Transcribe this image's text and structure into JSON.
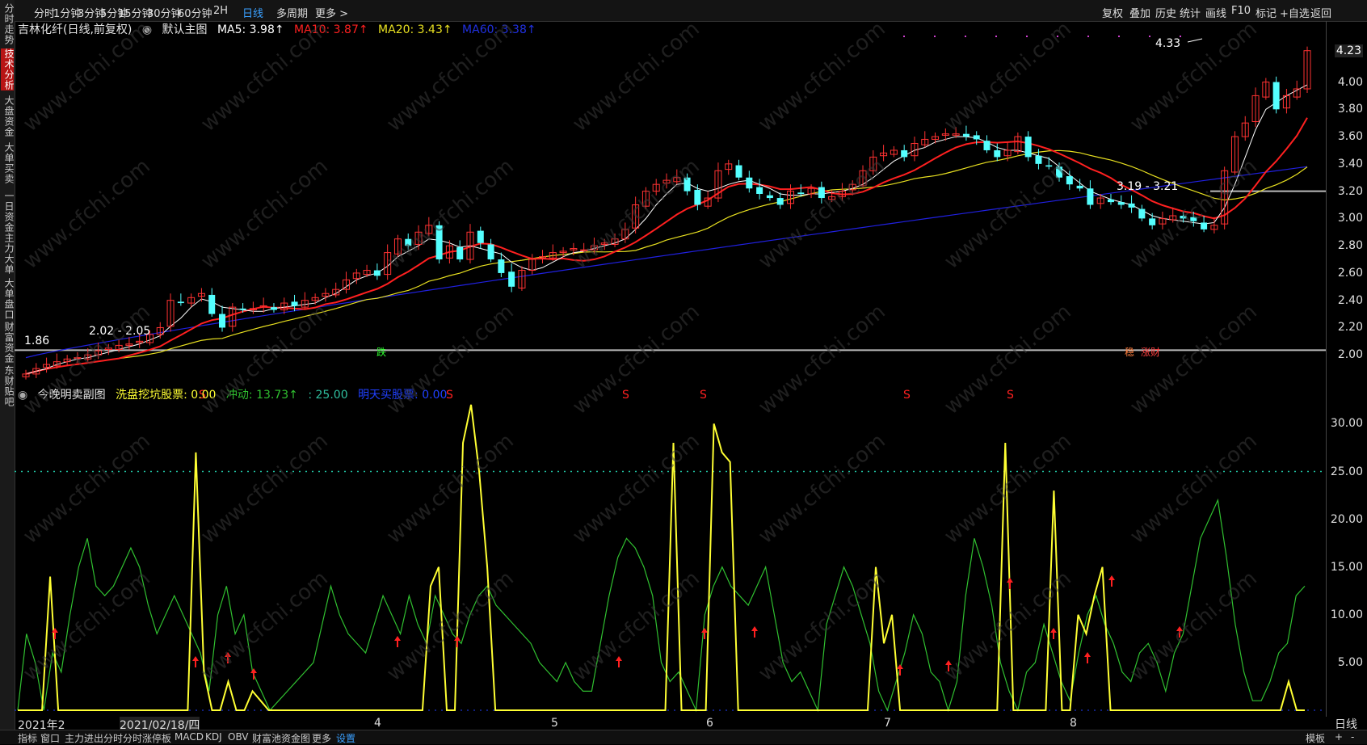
{
  "left_tabs": [
    "分时走势",
    "技术分析",
    "大盘资金",
    "大单买卖",
    "一日资金",
    "主力大单",
    "大单盘口",
    "财富资金",
    "东财贴吧"
  ],
  "left_active": 1,
  "periods": [
    "分时",
    "1分钟",
    "3分钟",
    "5分钟",
    "15分钟",
    "30分钟",
    "60分钟",
    "2H",
    "日线",
    "多周期",
    "更多 >"
  ],
  "period_active": "日线",
  "right_tools": [
    "复权",
    "叠加",
    "历史",
    "统计",
    "画线",
    "F10",
    "标记",
    "+自选",
    "返回"
  ],
  "main_legend": {
    "title": "吉林化纤(日线,前复权)",
    "chart_name": "默认主图",
    "ma5": "MA5: 3.98↑",
    "ma10": "MA10: 3.87↑",
    "ma20": "MA20: 3.43↑",
    "ma60": "MA60: 3.38↑"
  },
  "sub_legend": {
    "title": "今晚明卖副图",
    "xp": "洗盘挖坑股票: 0.00",
    "cd": "冲动: 13.73↑",
    "lv": ": 25.00",
    "mt": "明天买股票: 0.00"
  },
  "y_ticks_main": [
    "4.23",
    "4.00",
    "3.80",
    "3.60",
    "3.40",
    "3.20",
    "3.00",
    "2.80",
    "2.60",
    "2.40",
    "2.20",
    "2.00"
  ],
  "y_ticks_sub": [
    "30.00",
    "25.00",
    "20.00",
    "15.00",
    "10.00",
    "5.00"
  ],
  "x_labels": [
    "2021年2",
    "2021/02/18/四",
    "4",
    "5",
    "6",
    "7",
    "8"
  ],
  "x_axis_right": "日线",
  "annotations": {
    "high": "4.33",
    "low": "1.86",
    "range1": "2.02 - 2.05",
    "range2": "3.19 - 3.21",
    "marker1": "跌",
    "marker2": "稳",
    "marker3": "涨财"
  },
  "bottom_tabs": [
    "指标",
    "窗口",
    "主力进出分时",
    "分时涨停板",
    "MACD",
    "KDJ",
    "OBV",
    "财富池资金图",
    "更多",
    "设置"
  ],
  "bottom_active": "设置",
  "bottom_right": [
    "模板",
    "+",
    "-"
  ],
  "watermark": "www.cfchi.com",
  "colors": {
    "up": "#ff3232",
    "down": "#54ffff",
    "ma5": "#ffffff",
    "ma10": "#ff2020",
    "ma20": "#e8e020",
    "ma60": "#2020e0",
    "sub_yellow": "#ffff33",
    "sub_green": "#30c030"
  },
  "chart_data": [
    {
      "type": "candlestick",
      "title": "吉林化纤(日线,前复权)",
      "ylim": [
        1.8,
        4.4
      ],
      "close": [
        1.86,
        1.9,
        1.93,
        1.95,
        1.97,
        1.98,
        2.0,
        2.03,
        2.05,
        2.07,
        2.08,
        2.1,
        2.15,
        2.2,
        2.4,
        2.38,
        2.42,
        2.45,
        2.3,
        2.2,
        2.35,
        2.33,
        2.34,
        2.36,
        2.33,
        2.38,
        2.36,
        2.4,
        2.42,
        2.45,
        2.48,
        2.55,
        2.6,
        2.62,
        2.58,
        2.75,
        2.85,
        2.8,
        2.9,
        2.95,
        2.7,
        2.8,
        2.7,
        2.9,
        2.82,
        2.7,
        2.6,
        2.5,
        2.62,
        2.7,
        2.72,
        2.75,
        2.76,
        2.78,
        2.77,
        2.8,
        2.82,
        2.85,
        2.92,
        3.1,
        3.2,
        3.25,
        3.28,
        3.3,
        3.2,
        3.1,
        3.15,
        3.35,
        3.4,
        3.3,
        3.22,
        3.18,
        3.15,
        3.1,
        3.2,
        3.18,
        3.22,
        3.15,
        3.16,
        3.2,
        3.25,
        3.35,
        3.45,
        3.48,
        3.5,
        3.45,
        3.55,
        3.58,
        3.6,
        3.62,
        3.62,
        3.6,
        3.58,
        3.5,
        3.45,
        3.5,
        3.6,
        3.45,
        3.4,
        3.38,
        3.3,
        3.25,
        3.22,
        3.1,
        3.15,
        3.12,
        3.1,
        3.08,
        3.0,
        2.95,
        3.0,
        3.02,
        3.0,
        2.98,
        2.92,
        2.95,
        3.35,
        3.6,
        3.7,
        3.9,
        4.0,
        3.8,
        3.9,
        3.95,
        4.23
      ],
      "ma5": [
        1.86,
        1.88,
        1.9,
        1.93,
        1.95,
        1.97,
        1.98,
        2.0,
        2.02,
        2.04,
        2.06,
        2.08,
        2.11,
        2.14,
        2.21,
        2.27,
        2.35,
        2.41,
        2.39,
        2.35,
        2.34,
        2.33,
        2.32,
        2.32,
        2.34,
        2.35,
        2.36,
        2.37,
        2.38,
        2.42,
        2.45,
        2.5,
        2.55,
        2.58,
        2.6,
        2.65,
        2.72,
        2.76,
        2.8,
        2.85,
        2.84,
        2.82,
        2.79,
        2.8,
        2.78,
        2.76,
        2.74,
        2.68,
        2.64,
        2.62,
        2.64,
        2.68,
        2.72,
        2.75,
        2.76,
        2.78,
        2.8,
        2.82,
        2.85,
        2.92,
        3.0,
        3.1,
        3.18,
        3.25,
        3.26,
        3.22,
        3.2,
        3.22,
        3.25,
        3.27,
        3.28,
        3.25,
        3.22,
        3.18,
        3.17,
        3.17,
        3.18,
        3.18,
        3.19,
        3.2,
        3.22,
        3.25,
        3.3,
        3.36,
        3.42,
        3.46,
        3.5,
        3.52,
        3.56,
        3.58,
        3.6,
        3.6,
        3.59,
        3.56,
        3.52,
        3.5,
        3.5,
        3.48,
        3.46,
        3.44,
        3.38,
        3.32,
        3.26,
        3.2,
        3.17,
        3.14,
        3.12,
        3.1,
        3.06,
        3.02,
        3.0,
        2.99,
        2.98,
        2.97,
        2.96,
        2.97,
        3.08,
        3.25,
        3.45,
        3.65,
        3.8,
        3.85,
        3.9,
        3.94,
        3.98
      ]
    },
    {
      "type": "line",
      "title": "今晚明卖副图",
      "ylim": [
        0,
        33
      ],
      "series": [
        {
          "name": "洗盘挖坑股票",
          "values": [
            0,
            0,
            0,
            0,
            14,
            0,
            0,
            0,
            0,
            0,
            0,
            0,
            0,
            0,
            0,
            0,
            0,
            0,
            0,
            0,
            0,
            0,
            27,
            4,
            0,
            0,
            3,
            0,
            0,
            2,
            1,
            0,
            0,
            0,
            0,
            0,
            0,
            0,
            0,
            0,
            0,
            0,
            0,
            0,
            0,
            0,
            0,
            0,
            0,
            0,
            0,
            13,
            15,
            0,
            0,
            28,
            32,
            25,
            15,
            0,
            0,
            0,
            0,
            0,
            0,
            0,
            0,
            0,
            0,
            0,
            0,
            0,
            0,
            0,
            0,
            0,
            0,
            0,
            0,
            0,
            0,
            28,
            0,
            0,
            0,
            0,
            30,
            27,
            26,
            0,
            0,
            0,
            0,
            0,
            0,
            0,
            0,
            0,
            0,
            0,
            0,
            0,
            0,
            0,
            0,
            0,
            15,
            7,
            10,
            0,
            0,
            0,
            0,
            0,
            0,
            0,
            0,
            0,
            0,
            0,
            0,
            0,
            28,
            0,
            0,
            0,
            0,
            0,
            23,
            0,
            0,
            10,
            8,
            12,
            15,
            0,
            0,
            0,
            0,
            0,
            0,
            0,
            0,
            0,
            0,
            0,
            0,
            0,
            0,
            0,
            0,
            0,
            0,
            0,
            0,
            0,
            0,
            3,
            0,
            0
          ]
        },
        {
          "name": "冲动",
          "values": [
            0,
            8,
            5,
            0,
            6,
            4,
            10,
            15,
            18,
            13,
            12,
            13,
            15,
            17,
            15,
            11,
            8,
            10,
            12,
            10,
            8,
            6,
            2,
            10,
            13,
            8,
            10,
            4,
            2,
            0,
            1,
            2,
            3,
            4,
            5,
            9,
            13,
            10,
            8,
            7,
            6,
            9,
            12,
            10,
            8,
            12,
            9,
            7,
            12,
            10,
            8,
            7,
            10,
            12,
            13,
            11,
            10,
            9,
            8,
            7,
            5,
            4,
            3,
            5,
            3,
            2,
            2,
            7,
            12,
            16,
            18,
            17,
            15,
            12,
            5,
            3,
            4,
            2,
            0,
            10,
            13,
            15,
            13,
            12,
            11,
            13,
            15,
            10,
            5,
            3,
            4,
            2,
            0,
            9,
            12,
            15,
            13,
            10,
            7,
            2,
            0,
            3,
            6,
            10,
            8,
            4,
            3,
            0,
            3,
            12,
            18,
            15,
            11,
            5,
            2,
            0,
            4,
            5,
            9,
            6,
            3,
            1,
            6,
            10,
            12,
            9,
            7,
            4,
            3,
            6,
            7,
            5,
            2,
            6,
            8,
            13,
            18,
            20,
            22,
            16,
            9,
            4,
            1,
            1,
            3,
            6,
            7,
            12,
            13
          ]
        }
      ]
    }
  ]
}
